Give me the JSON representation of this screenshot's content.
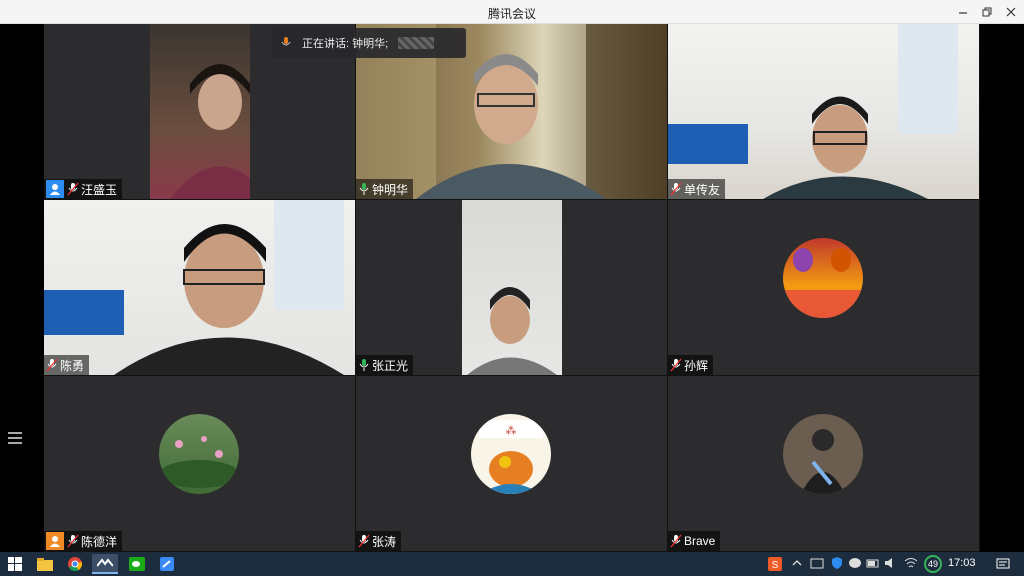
{
  "window": {
    "title": "腾讯会议"
  },
  "speaking_indicator": {
    "label": "正在讲话: 钟明华;"
  },
  "participants": [
    {
      "name": "汪盛玉",
      "host": true
    },
    {
      "name": "钟明华",
      "speaking": true
    },
    {
      "name": "单传友"
    },
    {
      "name": "陈勇"
    },
    {
      "name": "张正光",
      "speaking": true
    },
    {
      "name": "孙辉"
    },
    {
      "name": "陈德洋",
      "host": true
    },
    {
      "name": "张涛"
    },
    {
      "name": "Brave"
    }
  ],
  "taskbar": {
    "clock": "17:03",
    "battery_badge": "49"
  },
  "colors": {
    "speaking_border": "#35b35a",
    "host_badge": "#2d8cf0",
    "taskbar": "#1e2d3d"
  },
  "icons": [
    "windows-start-icon",
    "file-explorer-icon",
    "chrome-icon",
    "tencent-meeting-icon",
    "wechat-icon",
    "feishu-icon",
    "sogou-input-icon",
    "notification-icon"
  ]
}
